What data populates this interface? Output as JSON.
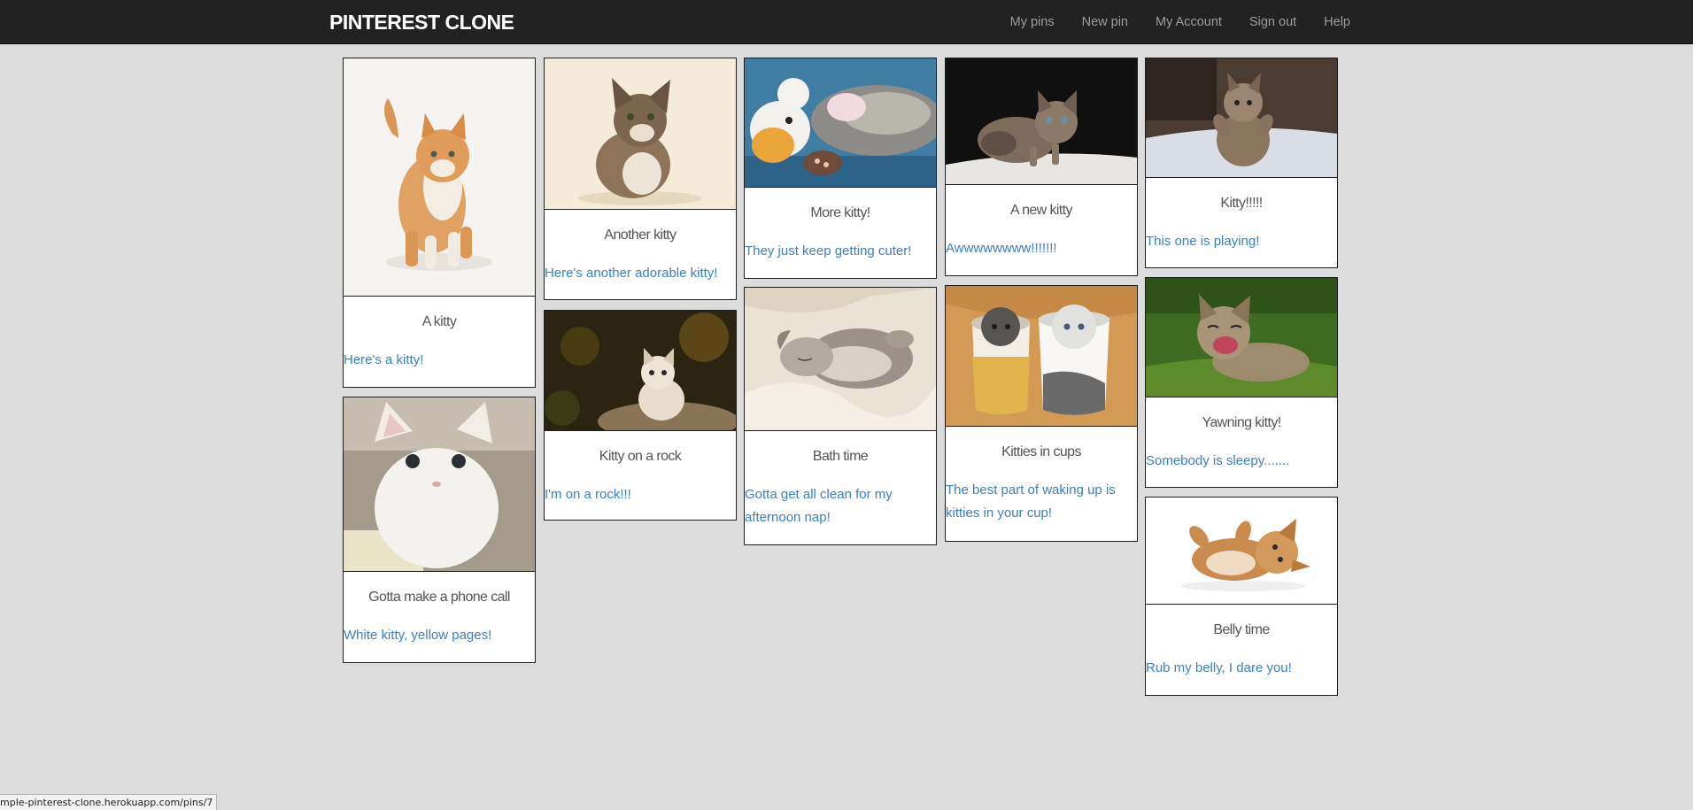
{
  "navbar": {
    "brand": "PINTEREST CLONE",
    "links": [
      "My pins",
      "New pin",
      "My Account",
      "Sign out",
      "Help"
    ]
  },
  "pins": [
    {
      "title": "A kitty",
      "description": "Here's a kitty!",
      "image": "orange-kitten-standing",
      "image_colors": [
        "#f6f4f1",
        "#d99655"
      ]
    },
    {
      "title": "Gotta make a phone call",
      "description": "White kitty, yellow pages!",
      "image": "white-kitten-on-phone-book",
      "image_colors": [
        "#a49b8d",
        "#f4f2ee"
      ]
    },
    {
      "title": "Another kitty",
      "description": "Here's another adorable kitty!",
      "image": "tabby-kitten-sitting",
      "image_colors": [
        "#f4ecd8",
        "#8d7358"
      ]
    },
    {
      "title": "Kitty on a rock",
      "description": "I'm on a rock!!!",
      "image": "kitten-on-rock",
      "image_colors": [
        "#2a2410",
        "#e8ddcc"
      ]
    },
    {
      "title": "More kitty!",
      "description": "They just keep getting cuter!",
      "image": "kitten-with-plush-toy",
      "image_colors": [
        "#3f7da3",
        "#8e8c88"
      ]
    },
    {
      "title": "Bath time",
      "description": "Gotta get all clean for my afternoon nap!",
      "image": "sleeping-kitten-blanket",
      "image_colors": [
        "#eae2d4",
        "#9c9189"
      ]
    },
    {
      "title": "A new kitty",
      "description": "Awwwwwwww!!!!!!!",
      "image": "kitten-on-dark-background",
      "image_colors": [
        "#101010",
        "#7d6c5c"
      ]
    },
    {
      "title": "Kitties in cups",
      "description": "The best part of waking up is kitties in your cup!",
      "image": "kittens-in-cups",
      "image_colors": [
        "#d39a55",
        "#efefef"
      ]
    },
    {
      "title": "Kitty!!!!!",
      "description": "This one is playing!",
      "image": "playing-kitten",
      "image_colors": [
        "#4a3b33",
        "#d8dde6"
      ]
    },
    {
      "title": "Yawning kitty!",
      "description": "Somebody is sleepy.......",
      "image": "yawning-kitten-grass",
      "image_colors": [
        "#3f6a21",
        "#9c8b6c"
      ]
    },
    {
      "title": "Belly time",
      "description": "Rub my belly, I dare you!",
      "image": "kitten-on-back",
      "image_colors": [
        "#ffffff",
        "#c98c4e"
      ]
    }
  ],
  "status_bar": {
    "url": "mple-pinterest-clone.herokuapp.com/pins/7"
  }
}
